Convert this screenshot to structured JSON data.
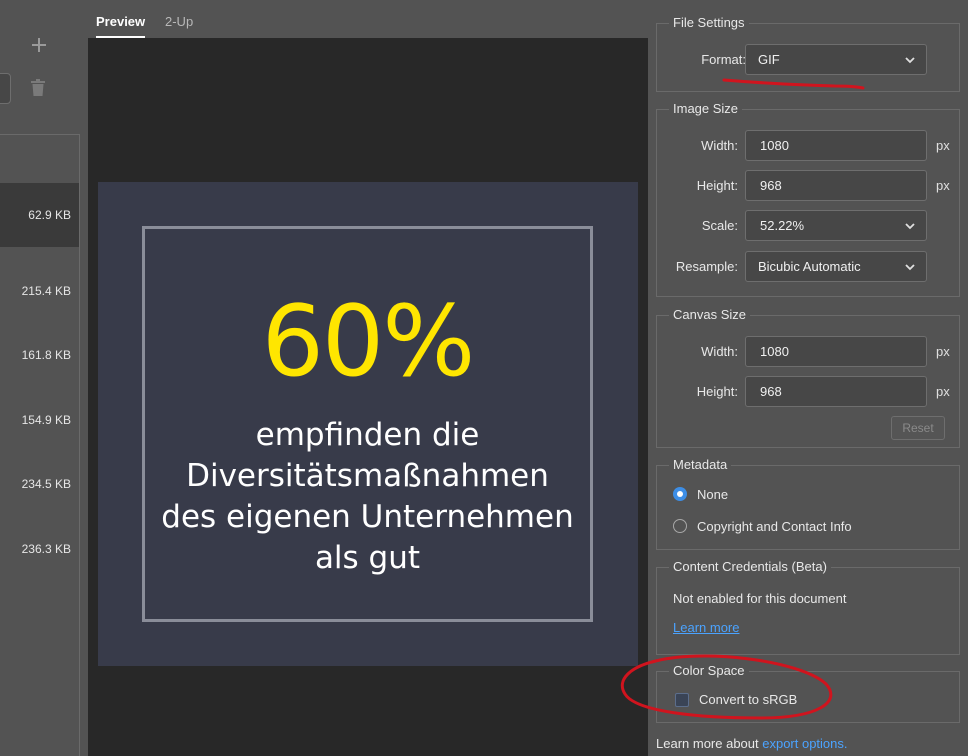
{
  "left_panel": {
    "preset_sizes": [
      "62.9 KB",
      "215.4 KB",
      "161.8 KB",
      "154.9 KB",
      "234.5 KB",
      "236.3 KB"
    ],
    "selected_index": 0
  },
  "tabs": [
    {
      "label": "Preview",
      "active": true
    },
    {
      "label": "2-Up",
      "active": false
    }
  ],
  "preview": {
    "big_number": "60%",
    "lines": [
      "empfinden die",
      "Diversitätsmaßnahmen",
      "des eigenen Unternehmen",
      "als gut"
    ],
    "accent_color": "#ffe600",
    "background_color": "#383b4a"
  },
  "file_settings": {
    "title": "File Settings",
    "format_label": "Format:",
    "format_value": "GIF"
  },
  "image_size": {
    "title": "Image Size",
    "width_label": "Width:",
    "width_value": "1080",
    "height_label": "Height:",
    "height_value": "968",
    "scale_label": "Scale:",
    "scale_value": "52.22%",
    "resample_label": "Resample:",
    "resample_value": "Bicubic Automatic",
    "unit": "px"
  },
  "canvas_size": {
    "title": "Canvas Size",
    "width_label": "Width:",
    "width_value": "1080",
    "height_label": "Height:",
    "height_value": "968",
    "unit": "px",
    "reset_label": "Reset"
  },
  "metadata": {
    "title": "Metadata",
    "options": [
      "None",
      "Copyright and Contact Info"
    ],
    "selected": "None"
  },
  "content_credentials": {
    "title": "Content Credentials (Beta)",
    "status": "Not enabled for this document",
    "learn_more": "Learn more"
  },
  "color_space": {
    "title": "Color Space",
    "convert_label": "Convert to sRGB",
    "checked": false
  },
  "footer": {
    "prefix": "Learn more about ",
    "link": "export options."
  },
  "annotation_color": "#d0141e"
}
